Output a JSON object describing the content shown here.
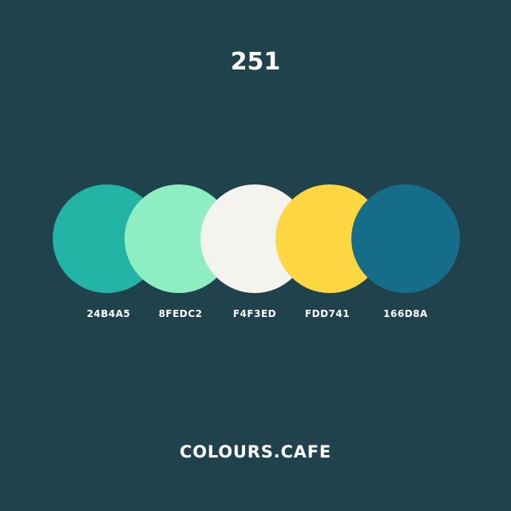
{
  "palette_number": "251",
  "colors": [
    {
      "hex_label": "24B4A5",
      "color": "#24B4A5"
    },
    {
      "hex_label": "8FEDC2",
      "color": "#8FEDC2"
    },
    {
      "hex_label": "F4F3ED",
      "color": "#F4F3ED"
    },
    {
      "hex_label": "FDD741",
      "color": "#FDD741"
    },
    {
      "hex_label": "166D8A",
      "color": "#166D8A"
    }
  ],
  "brand": "COLOURS.CAFE",
  "background_color": "#1F424D"
}
